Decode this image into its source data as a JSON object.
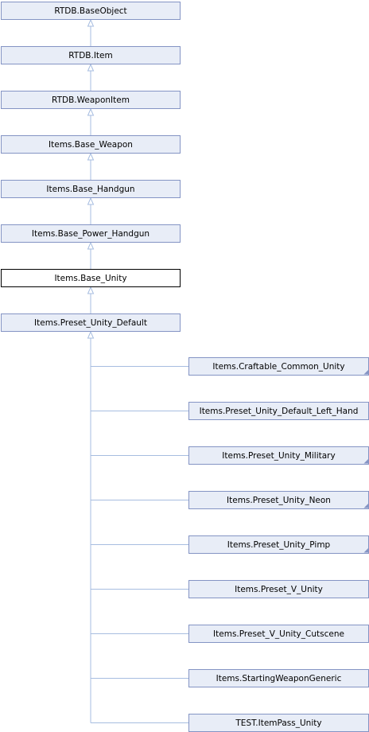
{
  "diagram": {
    "type": "class-inheritance-graph",
    "colors": {
      "node_fill": "#e8edf7",
      "node_border": "#8494c4",
      "current_fill": "#ffffff",
      "current_border": "#000000",
      "edge": "#a7bde0",
      "text": "#000000"
    },
    "ancestors": [
      "RTDB.BaseObject",
      "RTDB.Item",
      "RTDB.WeaponItem",
      "Items.Base_Weapon",
      "Items.Base_Handgun",
      "Items.Base_Power_Handgun"
    ],
    "current": "Items.Base_Unity",
    "child": "Items.Preset_Unity_Default",
    "descendants": [
      {
        "label": "Items.Craftable_Common_Unity",
        "has_more": true
      },
      {
        "label": "Items.Preset_Unity_Default_Left_Hand",
        "has_more": false
      },
      {
        "label": "Items.Preset_Unity_Military",
        "has_more": true
      },
      {
        "label": "Items.Preset_Unity_Neon",
        "has_more": true
      },
      {
        "label": "Items.Preset_Unity_Pimp",
        "has_more": true
      },
      {
        "label": "Items.Preset_V_Unity",
        "has_more": false
      },
      {
        "label": "Items.Preset_V_Unity_Cutscene",
        "has_more": false
      },
      {
        "label": "Items.StartingWeaponGeneric",
        "has_more": false
      },
      {
        "label": "TEST.ItemPass_Unity",
        "has_more": false
      }
    ]
  }
}
